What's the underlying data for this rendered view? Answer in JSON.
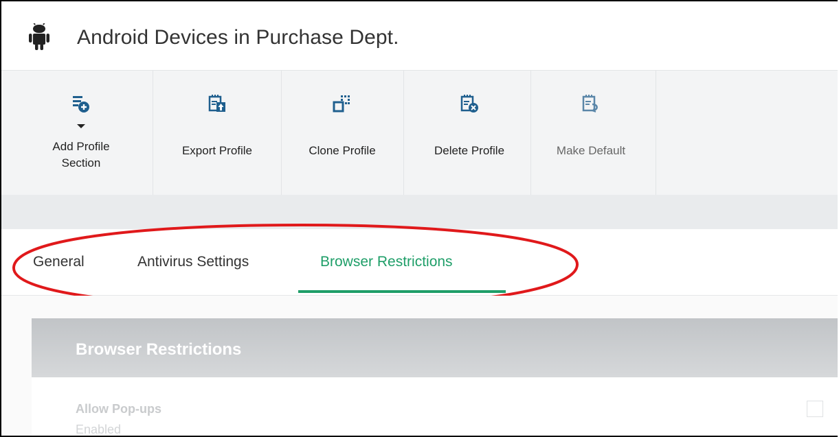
{
  "header": {
    "title": "Android Devices in Purchase Dept.",
    "icon": "android-icon"
  },
  "toolbar": {
    "add_profile_section": {
      "line1": "Add Profile",
      "line2": "Section",
      "icon": "add-section-icon"
    },
    "export_profile": {
      "label": "Export Profile",
      "icon": "export-icon"
    },
    "clone_profile": {
      "label": "Clone Profile",
      "icon": "clone-icon"
    },
    "delete_profile": {
      "label": "Delete Profile",
      "icon": "delete-icon"
    },
    "make_default": {
      "label": "Make Default",
      "icon": "make-default-icon",
      "disabled": true
    }
  },
  "tabs": [
    {
      "label": "General"
    },
    {
      "label": "Antivirus Settings"
    },
    {
      "label": "Browser Restrictions",
      "active": true
    }
  ],
  "section": {
    "title": "Browser Restrictions"
  },
  "settings": [
    {
      "label": "Allow Pop-ups",
      "value": "Enabled"
    }
  ],
  "colors": {
    "accent": "#1e9e68",
    "annotation": "#e0191b",
    "icon": "#1f5f8e"
  }
}
